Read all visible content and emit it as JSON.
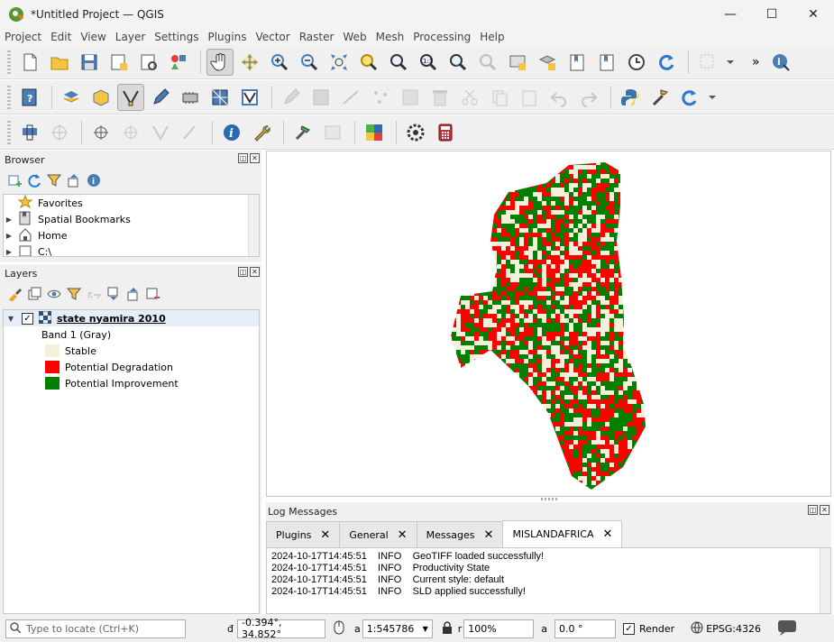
{
  "window": {
    "title": "*Untitled Project — QGIS",
    "minimize": "—",
    "maximize": "☐",
    "close": "✕"
  },
  "menu": [
    "Project",
    "Edit",
    "View",
    "Layer",
    "Settings",
    "Plugins",
    "Vector",
    "Raster",
    "Web",
    "Mesh",
    "Processing",
    "Help"
  ],
  "overflow": "»",
  "browser": {
    "title": "Browser",
    "items": [
      {
        "label": "Favorites",
        "icon": "star-icon"
      },
      {
        "label": "Spatial Bookmarks",
        "icon": "bookmark-icon"
      },
      {
        "label": "Home",
        "icon": "home-icon"
      },
      {
        "label": "C:\\",
        "icon": "drive-icon"
      }
    ]
  },
  "layers": {
    "title": "Layers",
    "layer_name": "state nyamira 2010",
    "band": "Band 1 (Gray)",
    "legend": [
      {
        "label": "Stable",
        "color": "#f5f0dc"
      },
      {
        "label": "Potential Degradation",
        "color": "#ff0000"
      },
      {
        "label": "Potential Improvement",
        "color": "#008000"
      }
    ]
  },
  "log": {
    "title": "Log Messages",
    "tabs": [
      "Plugins",
      "General",
      "Messages",
      "MISLANDAFRICA"
    ],
    "active_tab": "MISLANDAFRICA",
    "lines": [
      {
        "time": "2024-10-17T14:45:51",
        "level": "INFO",
        "msg": "GeoTIFF loaded successfully!"
      },
      {
        "time": "2024-10-17T14:45:51",
        "level": "INFO",
        "msg": "Productivity State"
      },
      {
        "time": "2024-10-17T14:45:51",
        "level": "INFO",
        "msg": "Current style: default"
      },
      {
        "time": "2024-10-17T14:45:51",
        "level": "INFO",
        "msg": "SLD applied successfully!"
      }
    ]
  },
  "status": {
    "locate_placeholder": "Type to locate (Ctrl+K)",
    "coord_label": "đ",
    "coordinate": "-0.394°, 34.852°",
    "scale_label": "a",
    "scale": "1:545786",
    "mag_label": "r",
    "magnifier": "100%",
    "rot_label": "a",
    "rotation": "0.0 °",
    "render_label": "Render",
    "crs": "EPSG:4326"
  }
}
